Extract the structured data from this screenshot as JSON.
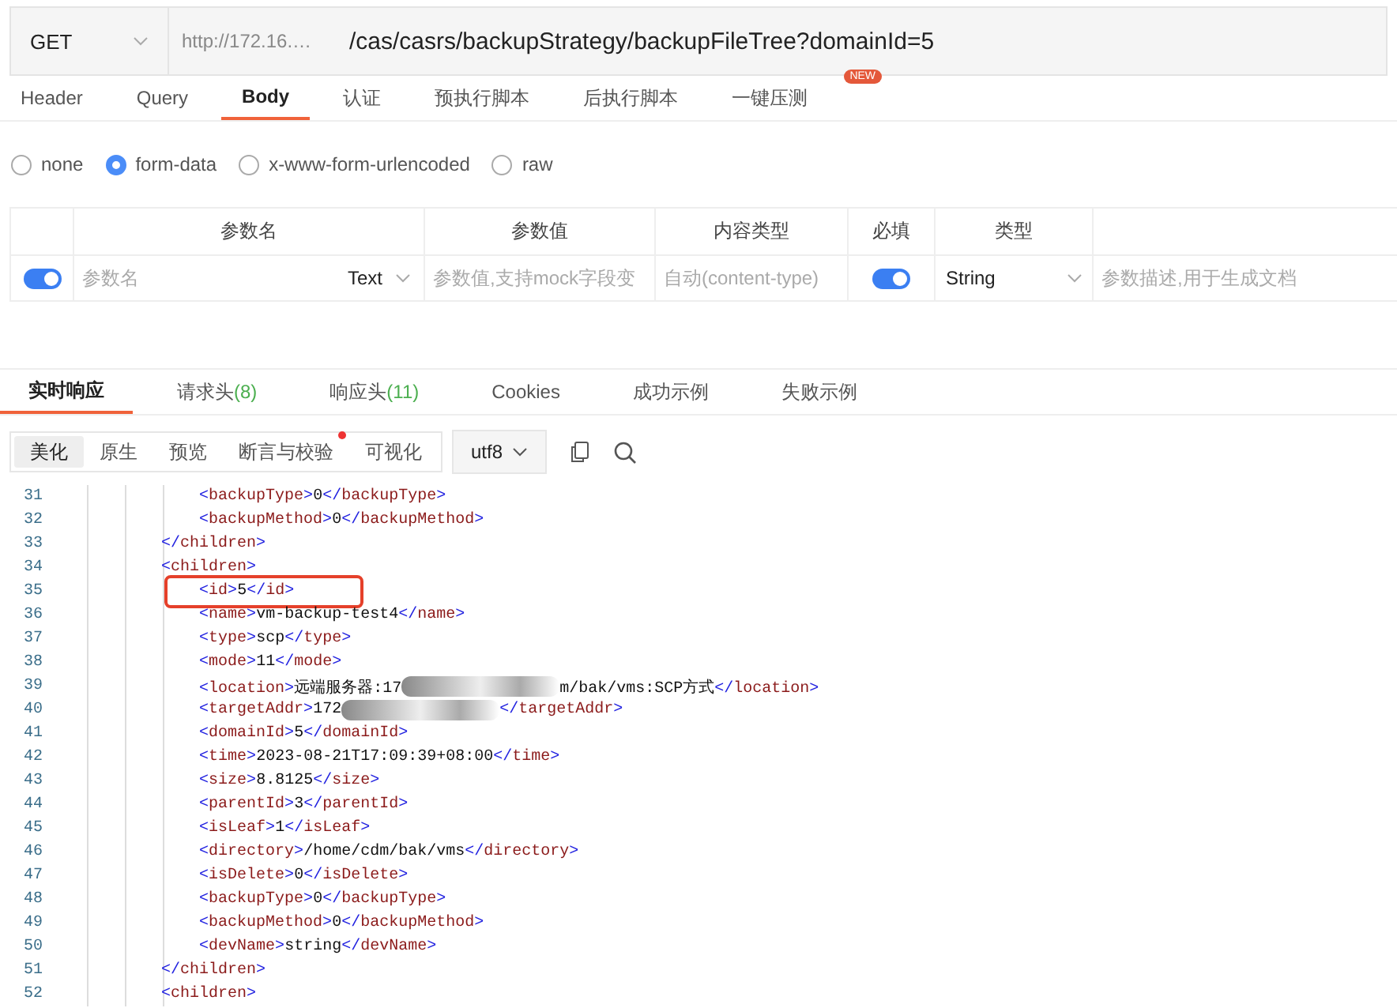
{
  "request": {
    "method": "GET",
    "base_url": "http://172.16.…",
    "path": "/cas/casrs/backupStrategy/backupFileTree?domainId=5"
  },
  "request_tabs": [
    {
      "label": "Header",
      "selected": false
    },
    {
      "label": "Query",
      "selected": false
    },
    {
      "label": "Body",
      "selected": true
    },
    {
      "label": "认证",
      "selected": false
    },
    {
      "label": "预执行脚本",
      "selected": false
    },
    {
      "label": "后执行脚本",
      "selected": false
    },
    {
      "label": "一键压测",
      "selected": false,
      "badge": "NEW"
    }
  ],
  "body_types": [
    {
      "label": "none",
      "selected": false
    },
    {
      "label": "form-data",
      "selected": true
    },
    {
      "label": "x-www-form-urlencoded",
      "selected": false
    },
    {
      "label": "raw",
      "selected": false
    }
  ],
  "params_table": {
    "columns": [
      "参数名",
      "参数值",
      "内容类型",
      "必填",
      "类型"
    ],
    "rows": [
      {
        "enabled": true,
        "name_placeholder": "参数名",
        "field_type": "Text",
        "value_placeholder": "参数值,支持mock字段变",
        "content_type_placeholder": "自动(content-type)",
        "required": true,
        "type": "String",
        "description_placeholder": "参数描述,用于生成文档"
      }
    ]
  },
  "response_tabs": [
    {
      "label": "实时响应",
      "selected": true
    },
    {
      "label": "请求头",
      "count": "(8)",
      "selected": false
    },
    {
      "label": "响应头",
      "count": "(11)",
      "selected": false
    },
    {
      "label": "Cookies",
      "selected": false
    },
    {
      "label": "成功示例",
      "selected": false
    },
    {
      "label": "失败示例",
      "selected": false
    }
  ],
  "view_modes": [
    {
      "label": "美化",
      "selected": true,
      "dot": false
    },
    {
      "label": "原生",
      "selected": false,
      "dot": false
    },
    {
      "label": "预览",
      "selected": false,
      "dot": false
    },
    {
      "label": "断言与校验",
      "selected": false,
      "dot": true
    },
    {
      "label": "可视化",
      "selected": false,
      "dot": false
    }
  ],
  "encoding": "utf8",
  "code_lines": [
    {
      "number": "31",
      "parts": [
        "                <backupType>0</backupType>"
      ],
      "highlighted": false
    },
    {
      "number": "32",
      "parts": [
        "                <backupMethod>0</backupMethod>"
      ],
      "highlighted": false
    },
    {
      "number": "33",
      "parts": [
        "            </children>"
      ],
      "highlighted": false
    },
    {
      "number": "34",
      "parts": [
        "            <children>"
      ],
      "highlighted": false
    },
    {
      "number": "35",
      "parts": [
        "                <id>5</id>"
      ],
      "highlighted": true
    },
    {
      "number": "36",
      "parts": [
        "                <name>vm-backup-test4</name>"
      ],
      "highlighted": false
    },
    {
      "number": "37",
      "parts": [
        "                <type>scp</type>"
      ],
      "highlighted": false
    },
    {
      "number": "38",
      "parts": [
        "                <mode>11</mode>"
      ],
      "highlighted": false
    },
    {
      "number": "39",
      "parts": [
        "                <location>远端服务器:17",
        "m/bak/vms:SCP方式</location>"
      ],
      "highlighted": false
    },
    {
      "number": "40",
      "parts": [
        "                <targetAddr>172",
        "</targetAddr>"
      ],
      "highlighted": false
    },
    {
      "number": "41",
      "parts": [
        "                <domainId>5</domainId>"
      ],
      "highlighted": false
    },
    {
      "number": "42",
      "parts": [
        "                <time>2023-08-21T17:09:39+08:00</time>"
      ],
      "highlighted": false
    },
    {
      "number": "43",
      "parts": [
        "                <size>8.8125</size>"
      ],
      "highlighted": false
    },
    {
      "number": "44",
      "parts": [
        "                <parentId>3</parentId>"
      ],
      "highlighted": false
    },
    {
      "number": "45",
      "parts": [
        "                <isLeaf>1</isLeaf>"
      ],
      "highlighted": false
    },
    {
      "number": "46",
      "parts": [
        "                <directory>/home/cdm/bak/vms</directory>"
      ],
      "highlighted": false
    },
    {
      "number": "47",
      "parts": [
        "                <isDelete>0</isDelete>"
      ],
      "highlighted": false
    },
    {
      "number": "48",
      "parts": [
        "                <backupType>0</backupType>"
      ],
      "highlighted": false
    },
    {
      "number": "49",
      "parts": [
        "                <backupMethod>0</backupMethod>"
      ],
      "highlighted": false
    },
    {
      "number": "50",
      "parts": [
        "                <devName>string</devName>"
      ],
      "highlighted": false
    },
    {
      "number": "51",
      "parts": [
        "            </children>"
      ],
      "highlighted": false
    },
    {
      "number": "52",
      "parts": [
        "            <children>"
      ],
      "highlighted": false
    }
  ]
}
